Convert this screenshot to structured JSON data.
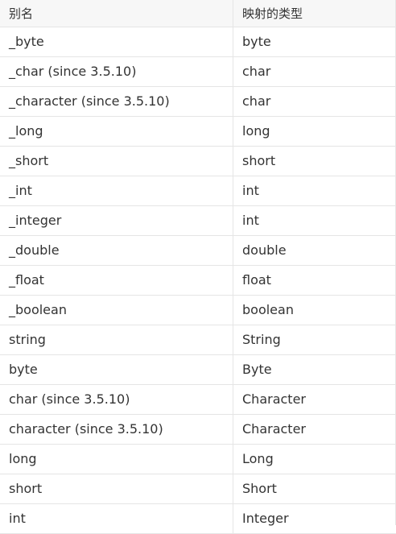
{
  "table": {
    "columns": [
      "别名",
      "映射的类型"
    ],
    "rows": [
      [
        "_byte",
        "byte"
      ],
      [
        "_char (since 3.5.10)",
        "char"
      ],
      [
        "_character (since 3.5.10)",
        "char"
      ],
      [
        "_long",
        "long"
      ],
      [
        "_short",
        "short"
      ],
      [
        "_int",
        "int"
      ],
      [
        "_integer",
        "int"
      ],
      [
        "_double",
        "double"
      ],
      [
        "_float",
        "float"
      ],
      [
        "_boolean",
        "boolean"
      ],
      [
        "string",
        "String"
      ],
      [
        "byte",
        "Byte"
      ],
      [
        "char (since 3.5.10)",
        "Character"
      ],
      [
        "character (since 3.5.10)",
        "Character"
      ],
      [
        "long",
        "Long"
      ],
      [
        "short",
        "Short"
      ],
      [
        "int",
        "Integer"
      ]
    ]
  },
  "colors": {
    "header_bg": "#f7f7f7",
    "border": "#e5e5e5",
    "text": "#333333"
  }
}
